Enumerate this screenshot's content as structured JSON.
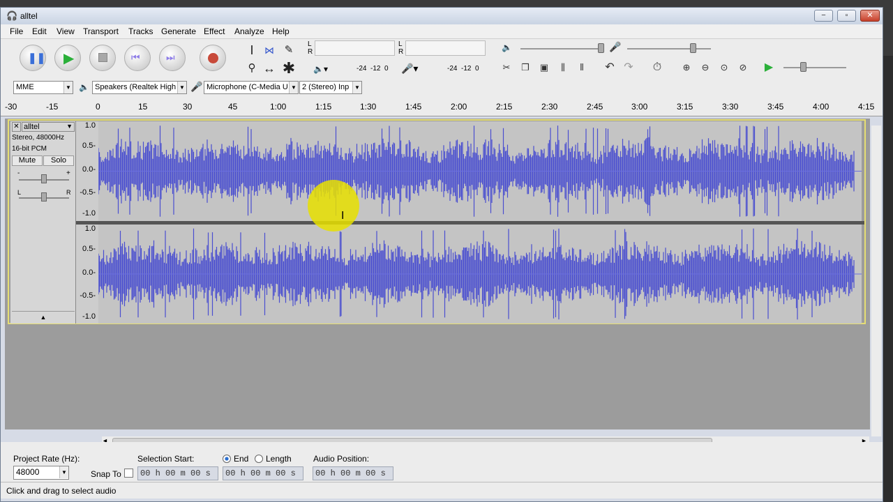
{
  "window": {
    "title": "alltel",
    "min_label": "−",
    "max_label": "▫",
    "close_label": "✕"
  },
  "menu": [
    "File",
    "Edit",
    "View",
    "Transport",
    "Tracks",
    "Generate",
    "Effect",
    "Analyze",
    "Help"
  ],
  "meters": {
    "left_channel": "L",
    "right_channel": "R",
    "scale_a": "-24  -12  0",
    "scale_b": "-24  -12  0"
  },
  "device": {
    "host": "MME",
    "output": "Speakers (Realtek High",
    "input": "Microphone (C-Media U",
    "channels": "2 (Stereo) Inp"
  },
  "ruler": [
    "-30",
    "-15",
    "0",
    "15",
    "30",
    "45",
    "1:00",
    "1:15",
    "1:30",
    "1:45",
    "2:00",
    "2:15",
    "2:30",
    "2:45",
    "3:00",
    "3:15",
    "3:30",
    "3:45",
    "4:00",
    "4:15"
  ],
  "track": {
    "close": "✕",
    "name": "alltel",
    "info1": "Stereo, 48000Hz",
    "info2": "16-bit PCM",
    "mute": "Mute",
    "solo": "Solo",
    "gain_min": "-",
    "gain_max": "+",
    "pan_left": "L",
    "pan_right": "R"
  },
  "vscale": [
    "1.0",
    "0.5-",
    "0.0-",
    "-0.5-",
    "-1.0"
  ],
  "bottom": {
    "project_rate_label": "Project Rate (Hz):",
    "project_rate": "48000",
    "snap_to": "Snap To",
    "selection_start": "Selection Start:",
    "end": "End",
    "length": "Length",
    "audio_position": "Audio Position:",
    "time1": "00 h 00 m 00 s",
    "time2": "00 h 00 m 00 s",
    "time3": "00 h 00 m 00 s"
  },
  "status": "Click and drag to select audio",
  "colors": {
    "waveform": "#4a4ed0",
    "track_border": "#e6de73",
    "cursor_highlight": "#e8e000"
  }
}
